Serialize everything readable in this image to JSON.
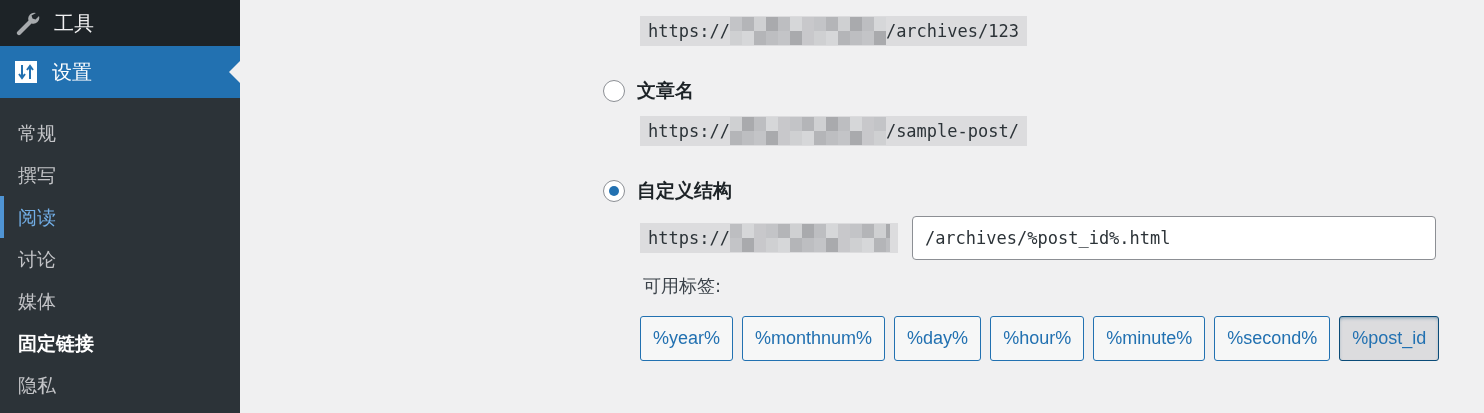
{
  "sidebar": {
    "items": [
      {
        "label": "工具",
        "selected": false
      },
      {
        "label": "设置",
        "selected": true
      }
    ],
    "submenu": [
      {
        "label": "常规",
        "selected": false,
        "highlighted": false
      },
      {
        "label": "撰写",
        "selected": false,
        "highlighted": false
      },
      {
        "label": "阅读",
        "selected": false,
        "highlighted": true
      },
      {
        "label": "讨论",
        "selected": false,
        "highlighted": false
      },
      {
        "label": "媒体",
        "selected": false,
        "highlighted": false
      },
      {
        "label": "固定链接",
        "selected": true,
        "highlighted": false
      },
      {
        "label": "隐私",
        "selected": false,
        "highlighted": false
      }
    ]
  },
  "permalink_options": [
    {
      "url_prefix": "https://",
      "url_suffix": "/archives/123"
    },
    {
      "label": "文章名",
      "selected": false,
      "url_prefix": "https://",
      "url_suffix": "/sample-post/"
    },
    {
      "label": "自定义结构",
      "selected": true,
      "url_prefix": "https://",
      "value": "/archives/%post_id%.html"
    }
  ],
  "available_tags": {
    "label": "可用标签:",
    "tags": [
      {
        "label": "%year%",
        "selected": false
      },
      {
        "label": "%monthnum%",
        "selected": false
      },
      {
        "label": "%day%",
        "selected": false
      },
      {
        "label": "%hour%",
        "selected": false
      },
      {
        "label": "%minute%",
        "selected": false
      },
      {
        "label": "%second%",
        "selected": false
      },
      {
        "label": "%post_id",
        "selected": true
      }
    ]
  }
}
